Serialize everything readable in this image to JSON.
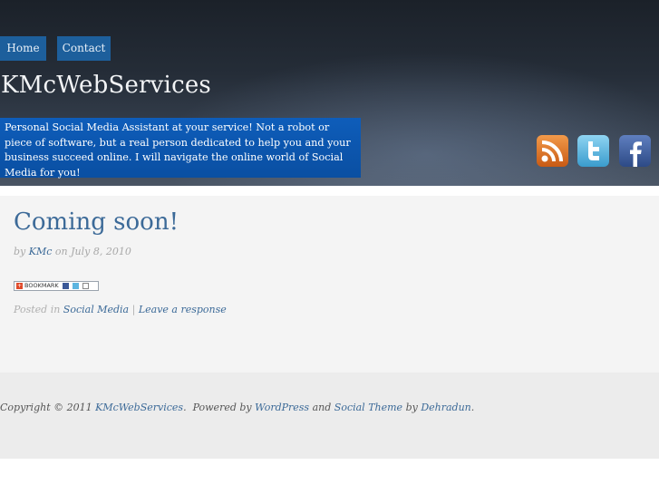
{
  "nav": {
    "home_label": "Home",
    "contact_label": "Contact"
  },
  "site": {
    "title": "KMcWebServices",
    "tagline": "Personal Social Media Assistant at your service! Not a robot or piece of software, but a real person dedicated to help you and your business succeed online. I will navigate the online world of Social Media for you!"
  },
  "social": {
    "icons": [
      "rss-icon",
      "twitter-icon",
      "facebook-icon"
    ],
    "colors": {
      "rss": "#e8762a",
      "twitter": "#5cb5e0",
      "facebook": "#3b5998"
    }
  },
  "post": {
    "title": "Coming soon!",
    "by_prefix": "by",
    "author": "KMc",
    "on_prefix": "on",
    "date": "July 8, 2010",
    "bookmark_label": "BOOKMARK",
    "posted_in_prefix": "Posted in",
    "category": "Social Media",
    "separator": "|",
    "response_link": "Leave a response"
  },
  "footer": {
    "copyright_prefix": "Copyright © 2011",
    "site_link": "KMcWebServices",
    "powered_text": ".  Powered by",
    "wordpress_link": "WordPress",
    "and_text": "and",
    "theme_link": "Social Theme",
    "by_text": "by",
    "author_link": "Dehradun",
    "end_text": "."
  },
  "colors": {
    "nav_bg": "#1d5f9c",
    "tagline_bg": "#0e5dba",
    "link": "#3c6a98"
  }
}
